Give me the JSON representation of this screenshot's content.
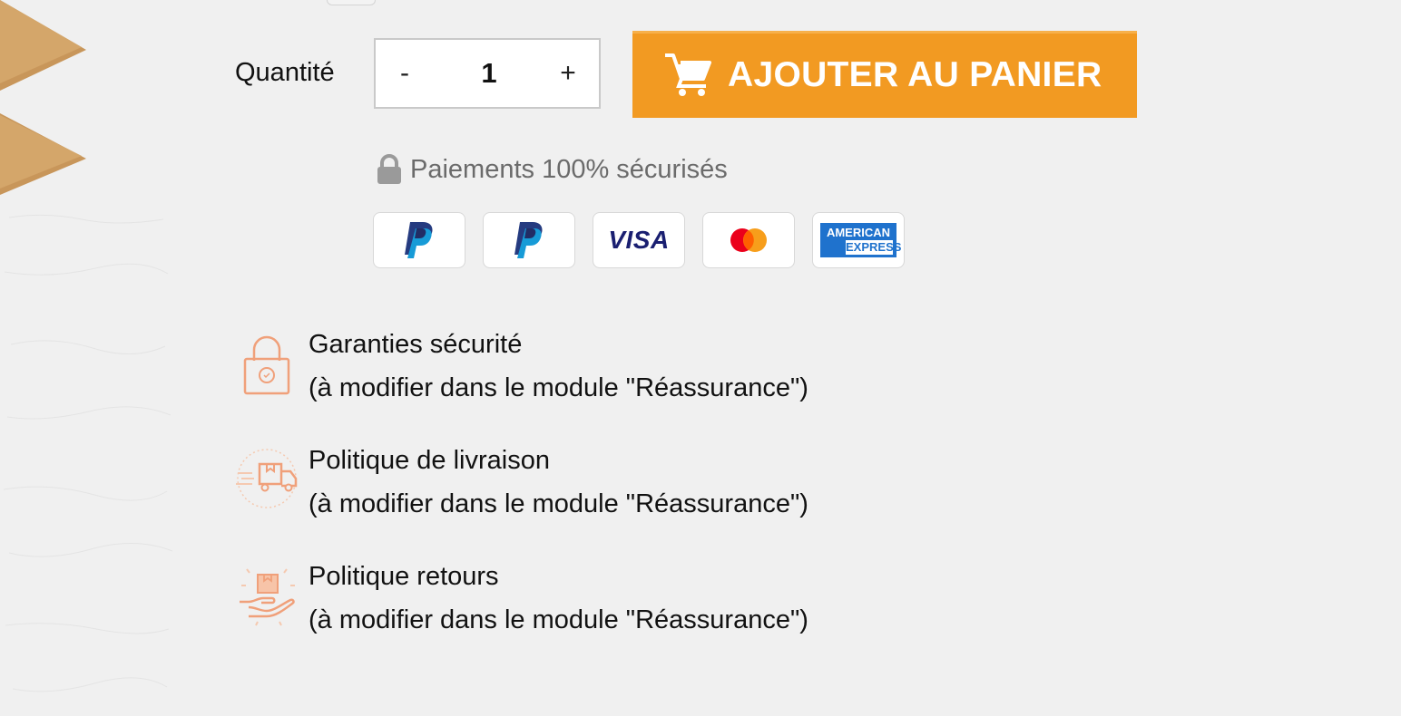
{
  "quantity": {
    "label": "Quantité",
    "minus": "-",
    "value": "1",
    "plus": "+"
  },
  "cart_button": {
    "label": "AJOUTER AU PANIER"
  },
  "payment": {
    "secure_text": "Paiements 100% sécurisés",
    "methods": [
      {
        "name": "PayPal",
        "icon": "paypal-icon"
      },
      {
        "name": "PayPal",
        "icon": "paypal-icon"
      },
      {
        "name": "Visa",
        "icon": "visa-icon",
        "logo_text": "VISA"
      },
      {
        "name": "Mastercard",
        "icon": "mastercard-icon"
      },
      {
        "name": "American Express",
        "icon": "amex-icon",
        "logo_line1": "AMERICAN",
        "logo_line2": "EXPRESS"
      }
    ]
  },
  "reassurance": [
    {
      "icon": "padlock-icon",
      "title": "Garanties sécurité",
      "description": "(à modifier dans le module \"Réassurance\")"
    },
    {
      "icon": "delivery-truck-icon",
      "title": "Politique de livraison",
      "description": "(à modifier dans le module \"Réassurance\")"
    },
    {
      "icon": "return-box-icon",
      "title": "Politique retours",
      "description": "(à modifier dans le module \"Réassurance\")"
    }
  ],
  "colors": {
    "accent": "#f29a22",
    "background": "#f0f0f0",
    "icon_tint": "#f0a07a",
    "muted_text": "#6b6b6b"
  }
}
